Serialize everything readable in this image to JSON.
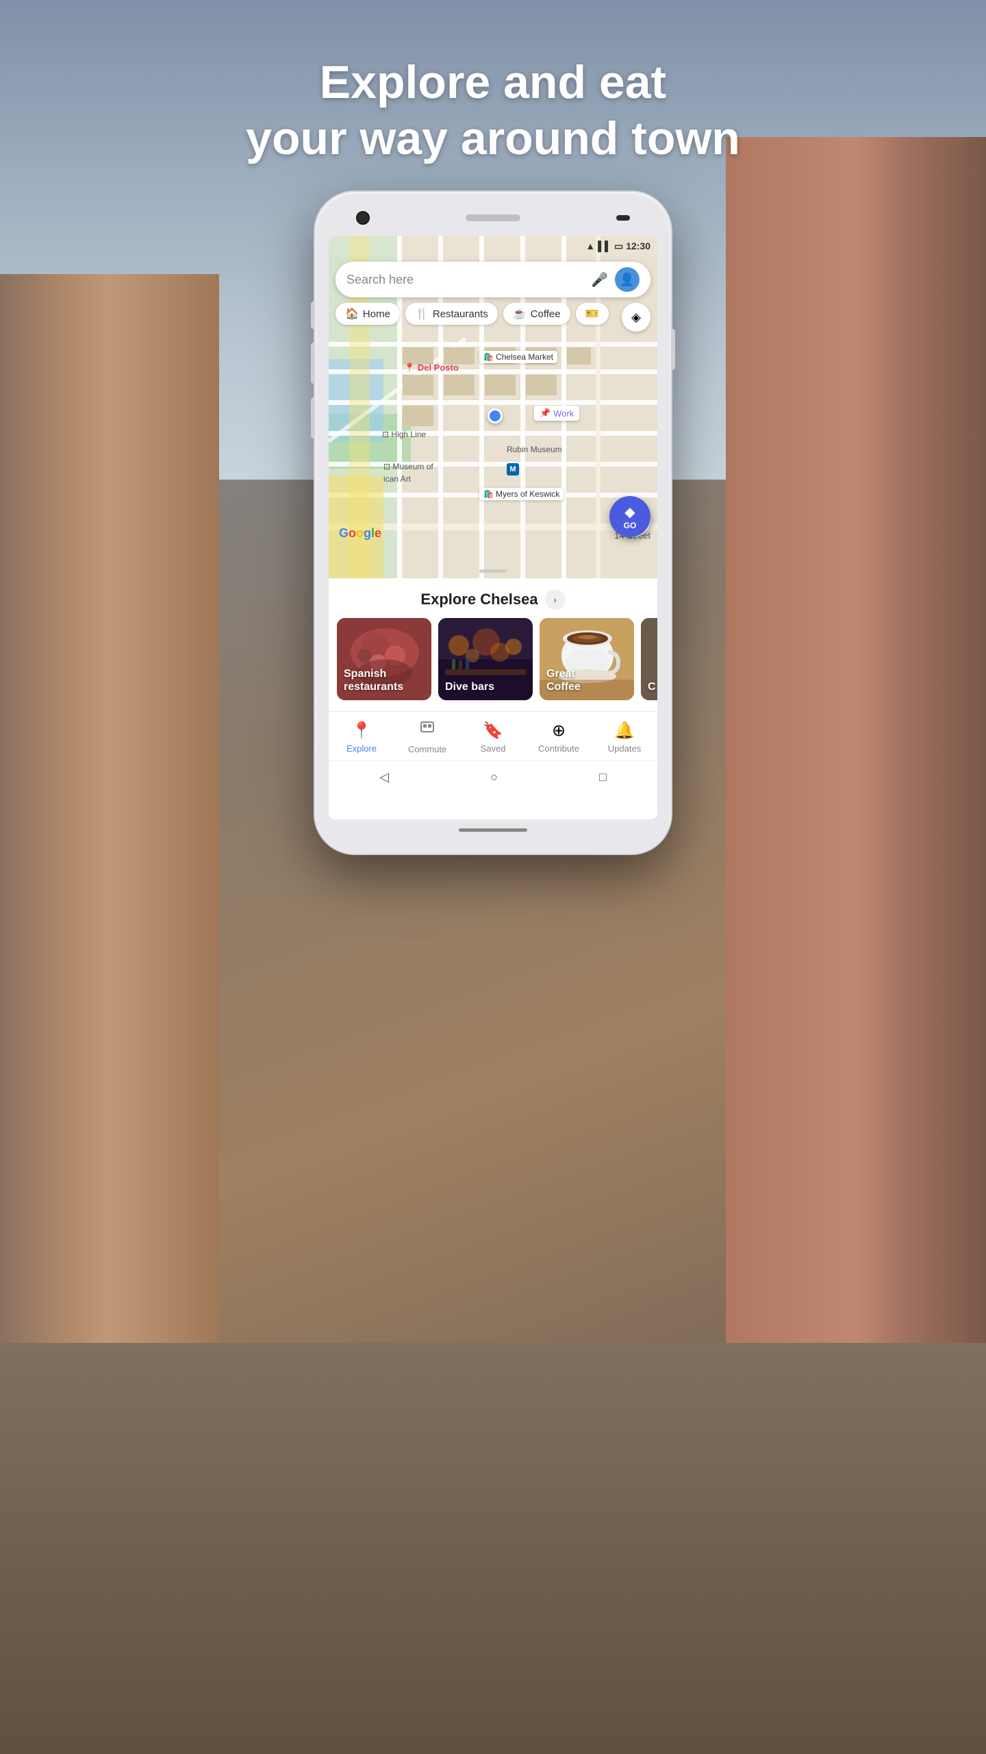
{
  "headline": {
    "line1": "Explore and eat",
    "line2": "your way around town"
  },
  "phone": {
    "status_bar": {
      "time": "12:30",
      "wifi_icon": "wifi",
      "signal_icon": "signal",
      "battery_icon": "battery"
    },
    "search": {
      "placeholder": "Search here"
    },
    "chips": [
      {
        "id": "home",
        "icon": "🏠",
        "label": "Home"
      },
      {
        "id": "restaurants",
        "icon": "🍴",
        "label": "Restaurants"
      },
      {
        "id": "coffee",
        "icon": "☕",
        "label": "Coffee"
      },
      {
        "id": "more",
        "icon": "🎫",
        "label": ""
      }
    ],
    "map": {
      "places": [
        {
          "name": "Chelsea Market",
          "type": "shopping"
        },
        {
          "name": "Del Posto",
          "type": "restaurant"
        },
        {
          "name": "Work",
          "type": "saved"
        },
        {
          "name": "High Line",
          "type": "park"
        },
        {
          "name": "Rubin Museum",
          "type": "museum"
        },
        {
          "name": "Myers of Keswick",
          "type": "shop"
        },
        {
          "name": "Museum of American Art",
          "type": "museum"
        },
        {
          "name": "14 Street",
          "type": "street"
        }
      ],
      "google_logo": "Google"
    },
    "explore": {
      "title": "Explore Chelsea",
      "cards": [
        {
          "id": "spanish",
          "label1": "Spanish",
          "label2": "restaurants",
          "bg": "spanish"
        },
        {
          "id": "dive",
          "label1": "Dive bars",
          "label2": "",
          "bg": "dive"
        },
        {
          "id": "coffee",
          "label1": "Great",
          "label2": "Coffee",
          "bg": "coffee"
        },
        {
          "id": "more",
          "label1": "C",
          "label2": "",
          "bg": "partial"
        }
      ]
    },
    "nav": {
      "items": [
        {
          "id": "explore",
          "icon": "📍",
          "label": "Explore",
          "active": true
        },
        {
          "id": "commute",
          "icon": "🏢",
          "label": "Commute",
          "active": false
        },
        {
          "id": "saved",
          "icon": "🔖",
          "label": "Saved",
          "active": false
        },
        {
          "id": "contribute",
          "icon": "⊕",
          "label": "Contribute",
          "active": false
        },
        {
          "id": "updates",
          "icon": "🔔",
          "label": "Updates",
          "active": false
        }
      ]
    },
    "go_button": {
      "label": "GO"
    }
  }
}
